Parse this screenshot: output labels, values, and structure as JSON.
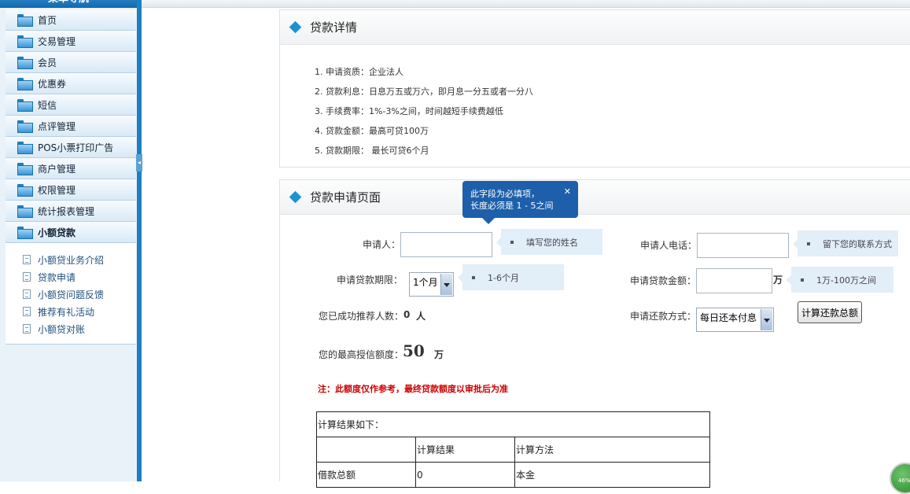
{
  "sidebar": {
    "title": "菜单导航",
    "items": [
      {
        "label": "首页"
      },
      {
        "label": "交易管理"
      },
      {
        "label": "会员"
      },
      {
        "label": "优惠券"
      },
      {
        "label": "短信"
      },
      {
        "label": "点评管理"
      },
      {
        "label": "POS小票打印广告"
      },
      {
        "label": "商户管理"
      },
      {
        "label": "权限管理"
      },
      {
        "label": "统计报表管理"
      },
      {
        "label": "小额贷款"
      }
    ],
    "subitems": [
      {
        "label": "小额贷业务介绍"
      },
      {
        "label": "贷款申请"
      },
      {
        "label": "小额贷问题反馈"
      },
      {
        "label": "推荐有礼活动"
      },
      {
        "label": "小额贷对账"
      }
    ]
  },
  "detail": {
    "title": "贷款详情",
    "items": [
      "1. 申请资质：企业法人",
      "2. 贷款利息：日息万五或万六，即月息一分五或者一分八",
      "3. 手续费率：1%-3%之间，时间越短手续费越低",
      "4. 贷款金额：最高可贷100万",
      "5. 贷款期限： 最长可贷6个月"
    ]
  },
  "apply": {
    "title": "贷款申请页面",
    "tooltip": {
      "line1": "此字段为必填项，",
      "line2": "长度必须是 1 - 5之间"
    },
    "applicant_label": "申请人：",
    "applicant_hint": "填写您的姓名",
    "phone_label": "申请人电话：",
    "phone_hint": "留下您的联系方式",
    "term_label": "申请贷款期限：",
    "term_value": "1个月",
    "term_hint": "1-6个月",
    "amount_label": "申请贷款金额：",
    "amount_unit": "万",
    "amount_hint": "1万-100万之间",
    "referral_label": "您已成功推荐人数：",
    "referral_count": "0",
    "referral_unit": "人",
    "repay_label": "申请还款方式：",
    "repay_value": "每日还本付息",
    "calc_button": "计算还款总额",
    "credit_label": "您的最高授信额度：",
    "credit_value": "50",
    "credit_unit": "万",
    "note": "注：此额度仅作参考，最终贷款额度以审批后为准"
  },
  "result": {
    "caption": "计算结果如下：",
    "headers": [
      "",
      "计算结果",
      "计算方法"
    ],
    "rows": [
      [
        "借款总额",
        "0",
        "本金"
      ]
    ]
  },
  "zoom": "46%"
}
